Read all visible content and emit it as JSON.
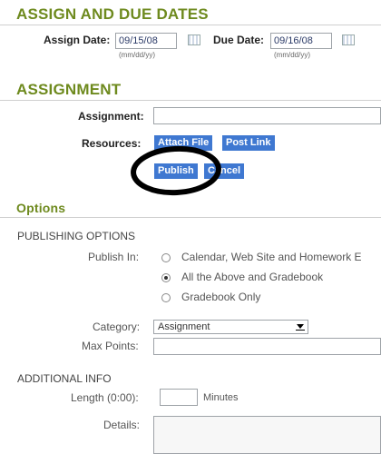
{
  "assign_dates": {
    "title": "ASSIGN AND DUE DATES",
    "assign_label": "Assign Date:",
    "assign_value": "09/15/08",
    "due_label": "Due Date:",
    "due_value": "09/16/08",
    "date_hint": "(mm/dd/yy)"
  },
  "assignment": {
    "title": "ASSIGNMENT",
    "assignment_label": "Assignment:",
    "assignment_value": "",
    "resources_label": "Resources:",
    "attach_label": "Attach File",
    "post_link_label": "Post Link",
    "publish_label": "Publish",
    "cancel_label": "Cancel"
  },
  "options": {
    "title": "Options",
    "publishing_heading": "PUBLISHING OPTIONS",
    "publish_in_label": "Publish In:",
    "radio_options": [
      {
        "label": "Calendar, Web Site and Homework E",
        "selected": false
      },
      {
        "label": "All the Above and Gradebook",
        "selected": true
      },
      {
        "label": "Gradebook Only",
        "selected": false
      }
    ],
    "category_label": "Category:",
    "category_value": "Assignment",
    "max_points_label": "Max Points:",
    "max_points_value": "",
    "additional_heading": "ADDITIONAL INFO",
    "length_label": "Length (0:00):",
    "length_value": "",
    "minutes_label": "Minutes",
    "details_label": "Details:",
    "details_value": ""
  },
  "colors": {
    "section_title": "#6e8a1e",
    "button": "#3f78d1",
    "annotation": "#000000"
  }
}
